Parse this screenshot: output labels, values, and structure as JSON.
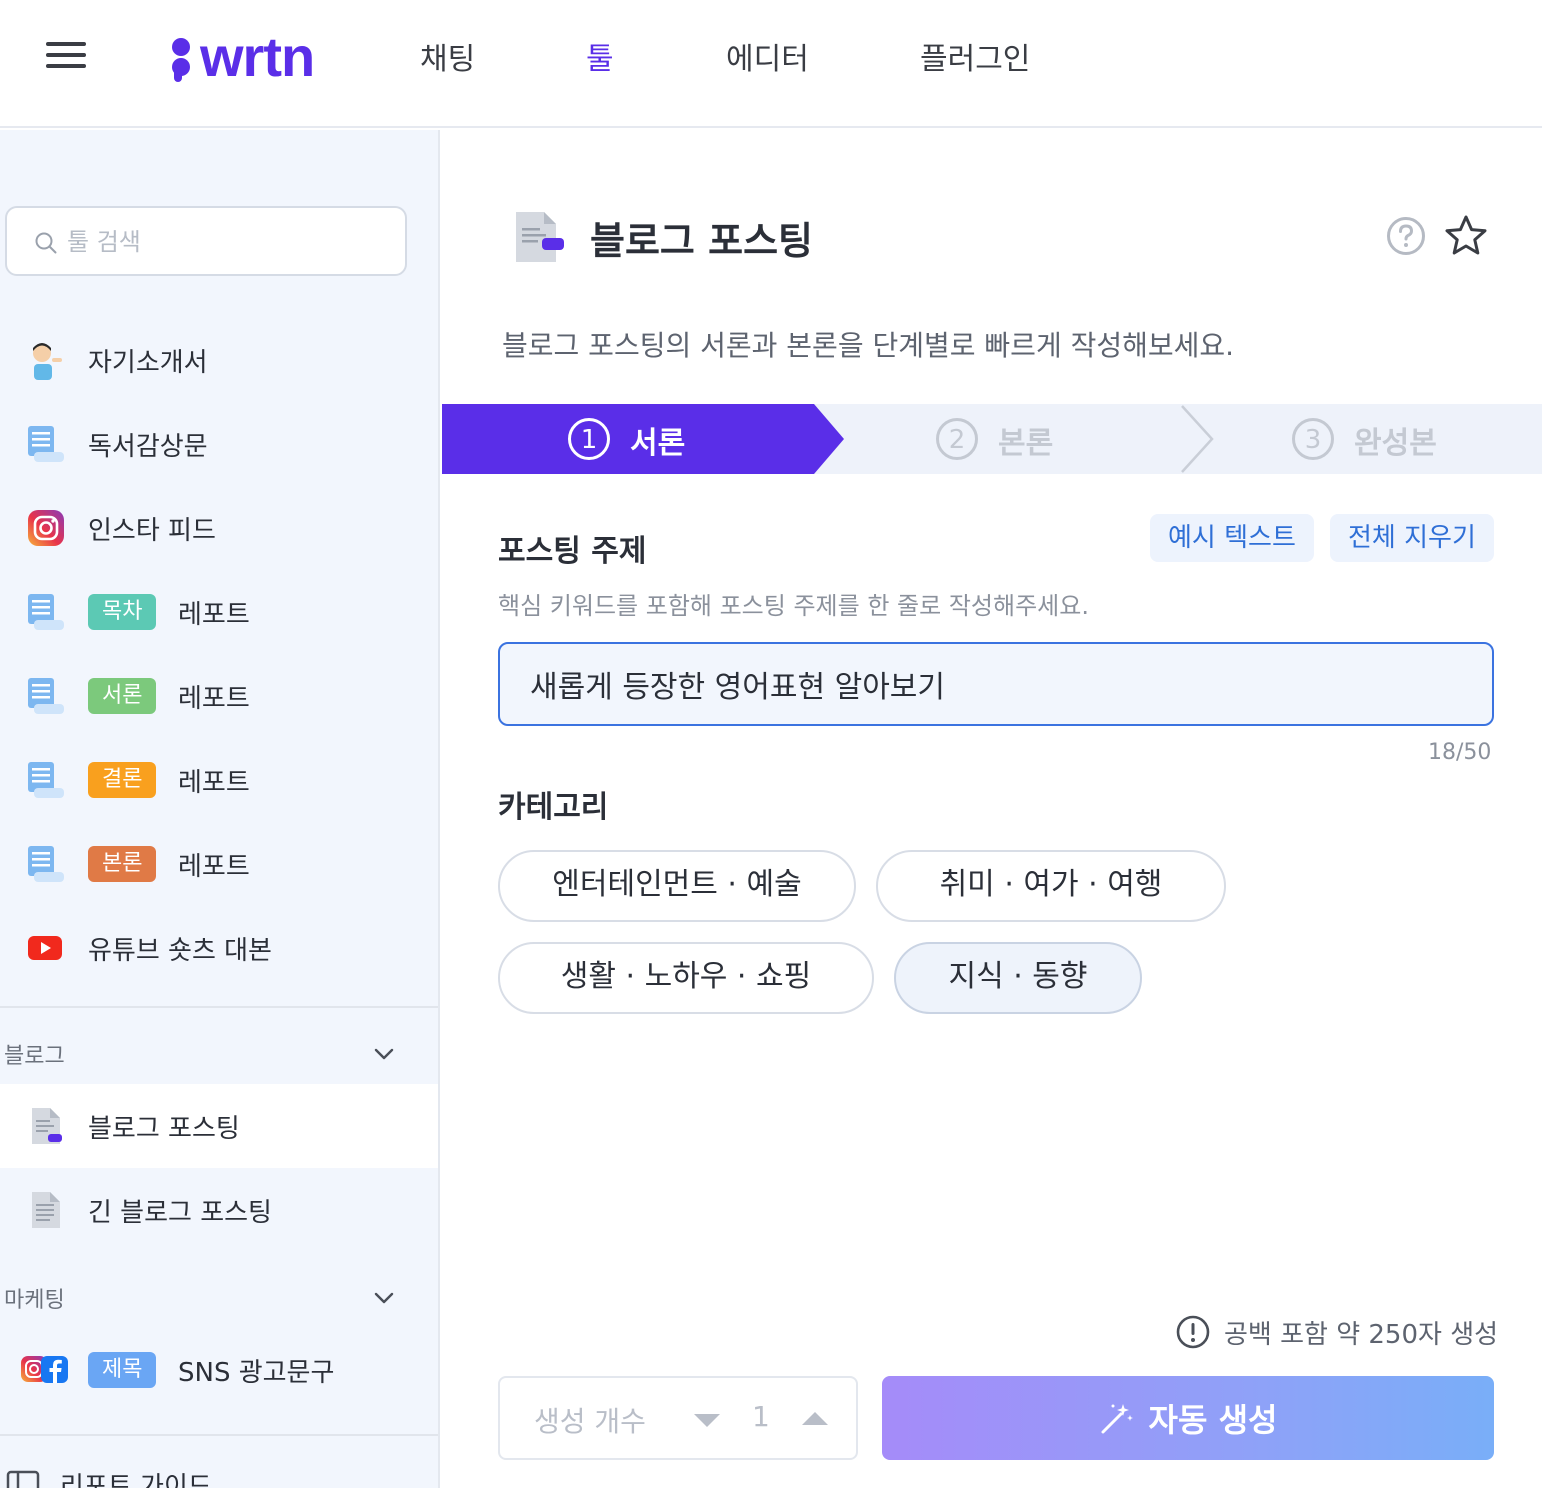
{
  "nav": {
    "logo_text": "wrtn",
    "links": [
      {
        "label": "채팅",
        "active": false
      },
      {
        "label": "툴",
        "active": true
      },
      {
        "label": "에디터",
        "active": false
      },
      {
        "label": "플러그인",
        "active": false
      }
    ]
  },
  "sidebar": {
    "search_placeholder": "툴 검색",
    "items": [
      {
        "label": "자기소개서",
        "icon": "person-icon"
      },
      {
        "label": "독서감상문",
        "icon": "scroll-icon"
      },
      {
        "label": "인스타 피드",
        "icon": "instagram-icon"
      },
      {
        "tag": "목차",
        "tag_color": "#5cc9b4",
        "label": "레포트",
        "icon": "scroll-icon"
      },
      {
        "tag": "서론",
        "tag_color": "#7cc97c",
        "label": "레포트",
        "icon": "scroll-icon"
      },
      {
        "tag": "결론",
        "tag_color": "#f9a01e",
        "label": "레포트",
        "icon": "scroll-icon"
      },
      {
        "tag": "본론",
        "tag_color": "#e07a46",
        "label": "레포트",
        "icon": "scroll-icon"
      },
      {
        "label": "유튜브 숏츠 대본",
        "icon": "youtube-icon"
      }
    ],
    "sections": [
      {
        "title": "블로그",
        "items": [
          {
            "label": "블로그 포스팅",
            "icon": "document-icon",
            "selected": true
          },
          {
            "label": "긴 블로그 포스팅",
            "icon": "document-icon",
            "selected": false
          }
        ]
      },
      {
        "title": "마케팅",
        "items": [
          {
            "tag": "제목",
            "tag_color": "#6aa6f4",
            "label": "SNS 광고문구",
            "icon": "instagram-facebook-icon"
          }
        ]
      },
      {
        "title": "리포트 가이드"
      }
    ]
  },
  "main": {
    "title": "블로그 포스팅",
    "description": "블로그 포스팅의 서론과 본론을 단계별로 빠르게 작성해보세요.",
    "steps": [
      {
        "num": "1",
        "label": "서론",
        "active": true
      },
      {
        "num": "2",
        "label": "본론",
        "active": false
      },
      {
        "num": "3",
        "label": "완성본",
        "active": false
      }
    ],
    "topic": {
      "title": "포스팅 주제",
      "hint": "핵심 키워드를 포함해 포스팅 주제를 한 줄로 작성해주세요.",
      "value": "새롭게 등장한 영어표현 알아보기",
      "counter": "18/50",
      "example_button": "예시 텍스트",
      "clear_button": "전체 지우기"
    },
    "category": {
      "title": "카테고리",
      "options": [
        {
          "label": "엔터테인먼트 · 예술",
          "selected": false
        },
        {
          "label": "취미 · 여가 · 여행",
          "selected": false
        },
        {
          "label": "생활 · 노하우 · 쇼핑",
          "selected": false
        },
        {
          "label": "지식 · 동향",
          "selected": true
        }
      ]
    },
    "generation_note": "공백 포함 약 250자 생성",
    "count_label": "생성 개수",
    "count_value": "1",
    "generate_button": "자동 생성",
    "colors": {
      "accent": "#5a2ee8",
      "link": "#2f6fd6"
    }
  }
}
